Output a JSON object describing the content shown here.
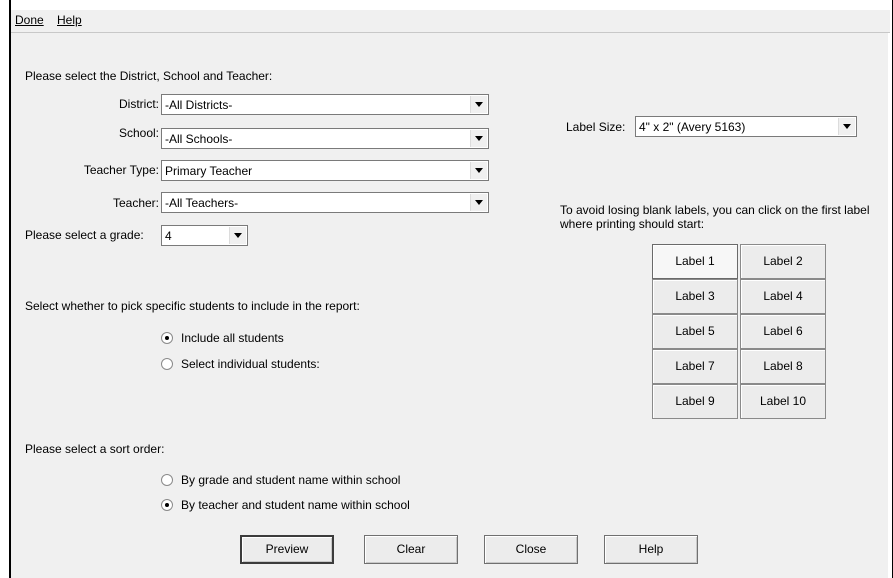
{
  "menu": {
    "done": "Done",
    "help": "Help"
  },
  "selection": {
    "heading": "Please select the District, School and Teacher:",
    "district_label": "District:",
    "district_value": "-All Districts-",
    "school_label": "School:",
    "school_value": "-All Schools-",
    "teacher_type_label": "Teacher Type:",
    "teacher_type_value": "Primary Teacher",
    "teacher_label": "Teacher:",
    "teacher_value": "-All Teachers-",
    "grade_label": "Please select a grade:",
    "grade_value": "4"
  },
  "label_size": {
    "label": "Label Size:",
    "value": "4\" x 2\" (Avery 5163)"
  },
  "label_start": {
    "line1": "To avoid losing blank labels, you can click on the first label",
    "line2": "where printing should start:",
    "buttons": [
      "Label 1",
      "Label 2",
      "Label 3",
      "Label 4",
      "Label 5",
      "Label 6",
      "Label 7",
      "Label 8",
      "Label 9",
      "Label 10"
    ]
  },
  "students": {
    "heading": "Select whether to pick specific students to include in the report:",
    "opt_all": "Include all students",
    "opt_individual": "Select individual students:"
  },
  "sort": {
    "heading": "Please select a sort order:",
    "opt_grade": "By grade and student name within school",
    "opt_teacher": "By teacher and student name within school"
  },
  "actions": {
    "preview": "Preview",
    "clear": "Clear",
    "close": "Close",
    "help": "Help"
  }
}
